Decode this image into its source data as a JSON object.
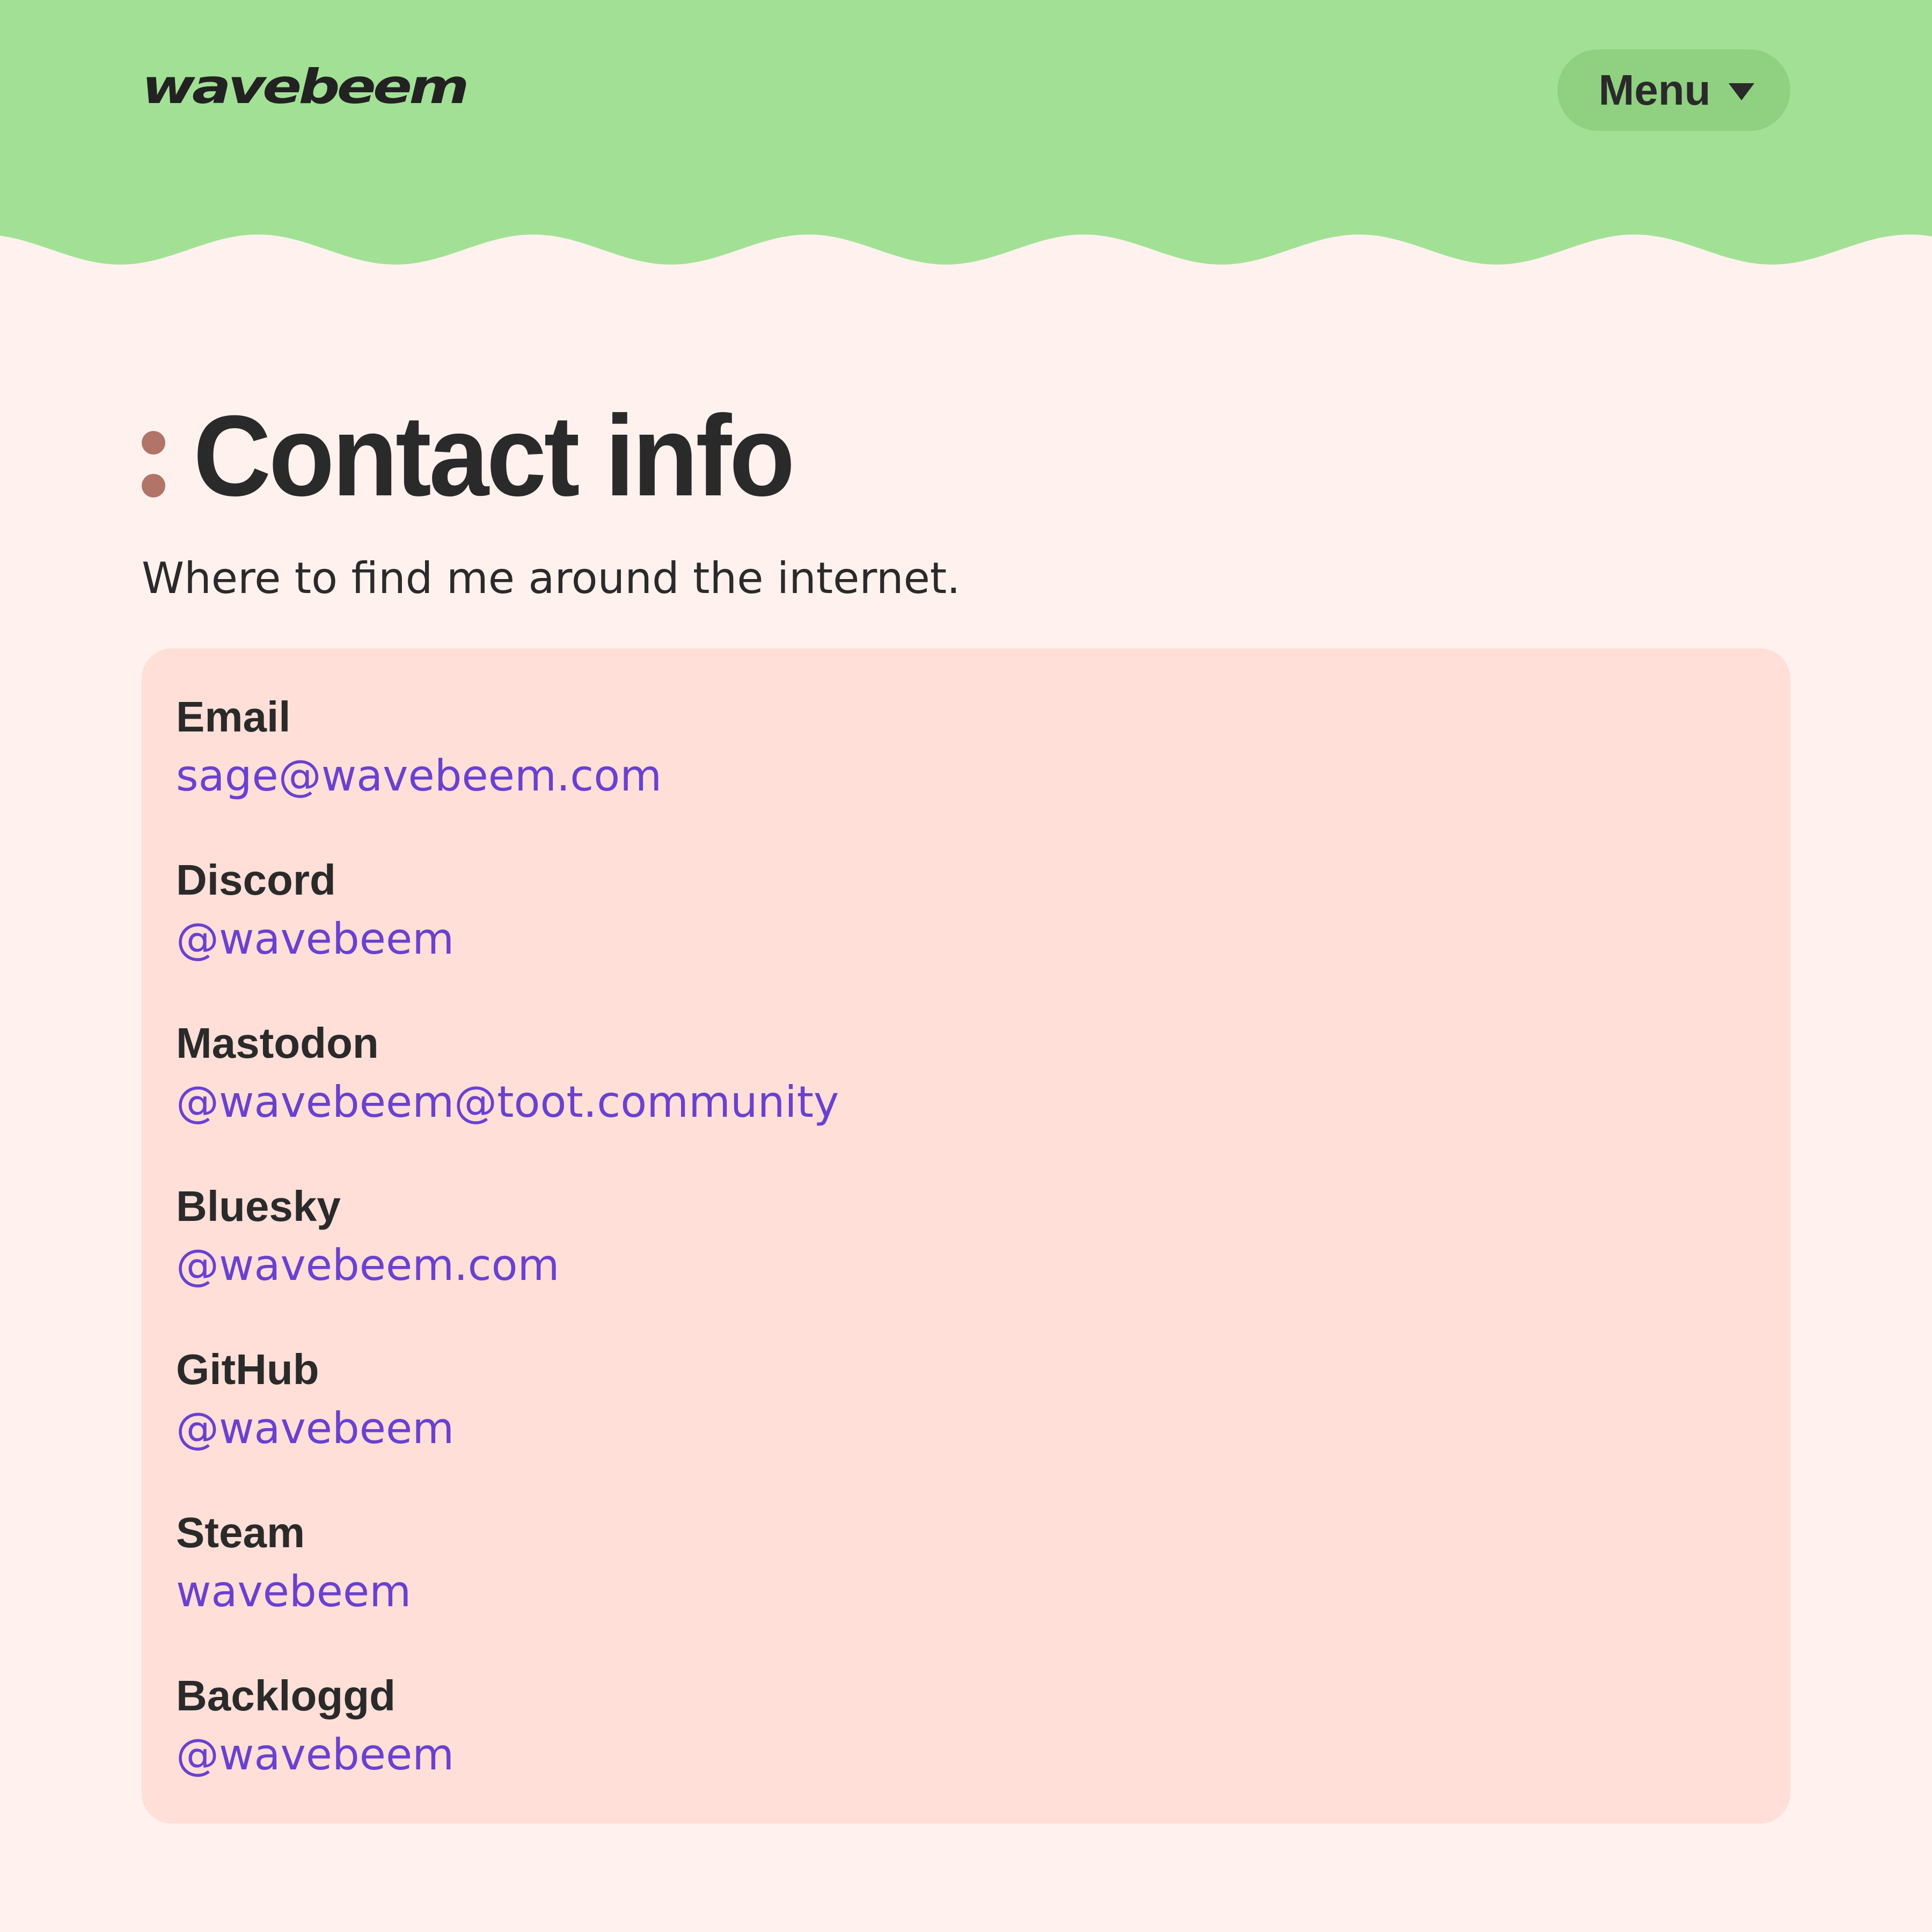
{
  "header": {
    "logo_text": "wavebeem",
    "menu_label": "Menu",
    "menu_icon": "caret-down-icon",
    "background_color": "#a2e195",
    "menu_button_color": "#8fd081"
  },
  "main": {
    "title_icon": "colon-icon",
    "title": "Contact info",
    "subtitle": "Where to find me around the internet.",
    "contacts": [
      {
        "label": "Email",
        "value": "sage@wavebeem.com"
      },
      {
        "label": "Discord",
        "value": "@wavebeem"
      },
      {
        "label": "Mastodon",
        "value": "@wavebeem@toot.community"
      },
      {
        "label": "Bluesky",
        "value": "@wavebeem.com"
      },
      {
        "label": "GitHub",
        "value": "@wavebeem"
      },
      {
        "label": "Steam",
        "value": "wavebeem"
      },
      {
        "label": "Backloggd",
        "value": "@wavebeem"
      }
    ]
  },
  "colors": {
    "page_background": "#fff2ee",
    "card_background": "#ffdfd8",
    "link_color": "#6a41cf",
    "text_color": "#2b2a2a",
    "accent_dot": "#b27468"
  }
}
